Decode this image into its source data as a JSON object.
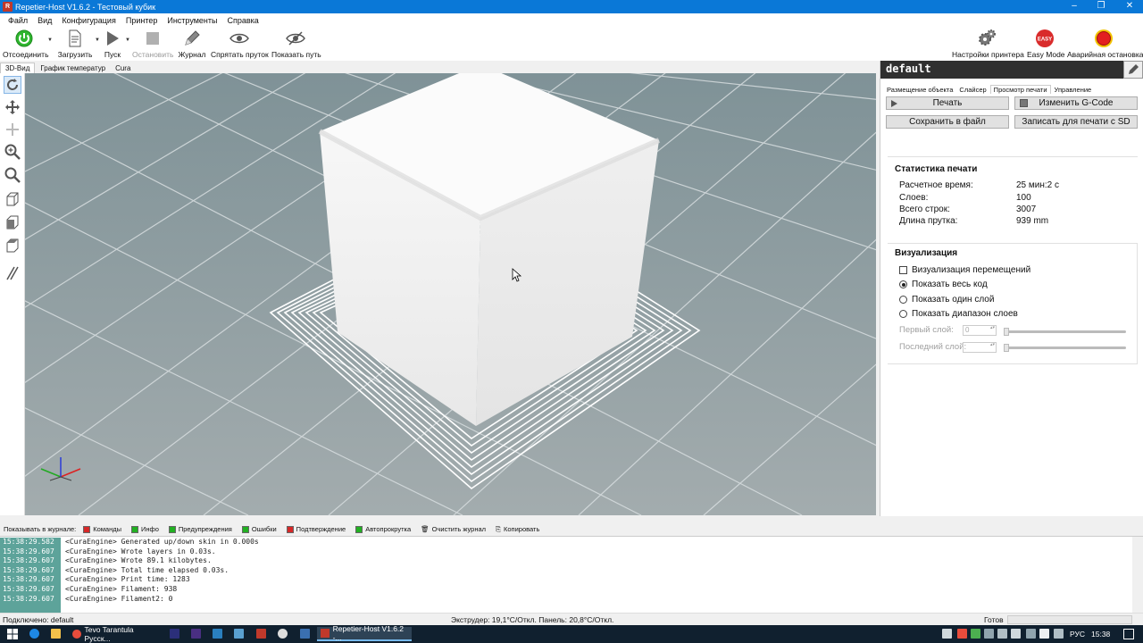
{
  "window": {
    "title": "Repetier-Host V1.6.2 - Тестовый кубик",
    "app_icon": "R"
  },
  "menu": [
    "Файл",
    "Вид",
    "Конфигурация",
    "Принтер",
    "Инструменты",
    "Справка"
  ],
  "toolbar": {
    "disconnect": "Отсоединить",
    "load": "Загрузить",
    "run": "Пуск",
    "stop": "Остановить",
    "log": "Журнал",
    "hide_filament": "Спрятать пруток",
    "show_path": "Показать путь",
    "printer_settings": "Настройки принтера",
    "easy_mode": "Easy Mode",
    "easy_badge": "EASY",
    "emergency": "Аварийная остановка"
  },
  "view_tabs": [
    "3D-Вид",
    "График температур",
    "Cura"
  ],
  "right_panel": {
    "profile": "default",
    "tabs": [
      "Размещение объекта",
      "Слайсер",
      "Просмотр печати",
      "Управление"
    ],
    "active_tab": "Просмотр печати",
    "buttons": {
      "print": "Печать",
      "edit_gcode": "Изменить G-Code",
      "save_file": "Сохранить в файл",
      "write_sd": "Записать для печати с SD"
    },
    "stats": {
      "title": "Статистика печати",
      "rows": [
        {
          "label": "Расчетное время:",
          "value": "25 мин:2 с"
        },
        {
          "label": "Слоев:",
          "value": "100"
        },
        {
          "label": "Всего строк:",
          "value": "3007"
        },
        {
          "label": "Длина прутка:",
          "value": "939 mm"
        }
      ]
    },
    "visual": {
      "title": "Визуализация",
      "show_moves": "Визуализация перемещений",
      "options": [
        "Показать весь код",
        "Показать один слой",
        "Показать диапазон слоев"
      ],
      "selected_option": 0,
      "first_layer_label": "Первый слой:",
      "last_layer_label": "Последний слой:",
      "first_layer_value": "0",
      "last_layer_value": ""
    }
  },
  "log_filters": {
    "label": "Показывать в журнале:",
    "items": [
      {
        "label": "Команды",
        "color": "#d62828"
      },
      {
        "label": "Инфо",
        "color": "#22b022"
      },
      {
        "label": "Предупреждения",
        "color": "#22b022"
      },
      {
        "label": "Ошибки",
        "color": "#22b022"
      },
      {
        "label": "Подтверждение",
        "color": "#d62828"
      },
      {
        "label": "Автопрокрутка",
        "color": "#22b022"
      }
    ],
    "clear": "Очистить журнал",
    "copy": "Копировать"
  },
  "log": [
    {
      "time": "15:38:29.582",
      "msg": "<CuraEngine> Generated up/down skin in 0.000s"
    },
    {
      "time": "15:38:29.607",
      "msg": "<CuraEngine> Wrote layers in  0.03s."
    },
    {
      "time": "15:38:29.607",
      "msg": "<CuraEngine> Wrote  89.1 kilobytes."
    },
    {
      "time": "15:38:29.607",
      "msg": "<CuraEngine> Total time elapsed  0.03s."
    },
    {
      "time": "15:38:29.607",
      "msg": "<CuraEngine> Print time: 1283"
    },
    {
      "time": "15:38:29.607",
      "msg": "<CuraEngine> Filament: 938"
    },
    {
      "time": "15:38:29.607",
      "msg": "<CuraEngine> Filament2: 0"
    }
  ],
  "status": {
    "connection": "Подключено: default",
    "temps": "Экструдер: 19,1°C/Откл. Панель: 20,8°C/Откл.",
    "state": "Готов"
  },
  "taskbar": {
    "browser_task": "Tevo Tarantula Русск...",
    "app_task": "Repetier-Host V1.6.2 -...",
    "lang": "РУС",
    "clock": "15:38"
  },
  "colors": {
    "titlebar": "#0a78d7",
    "accent": "#22b022",
    "log_time_bg": "#5da39a",
    "profile_header": "#303030"
  }
}
